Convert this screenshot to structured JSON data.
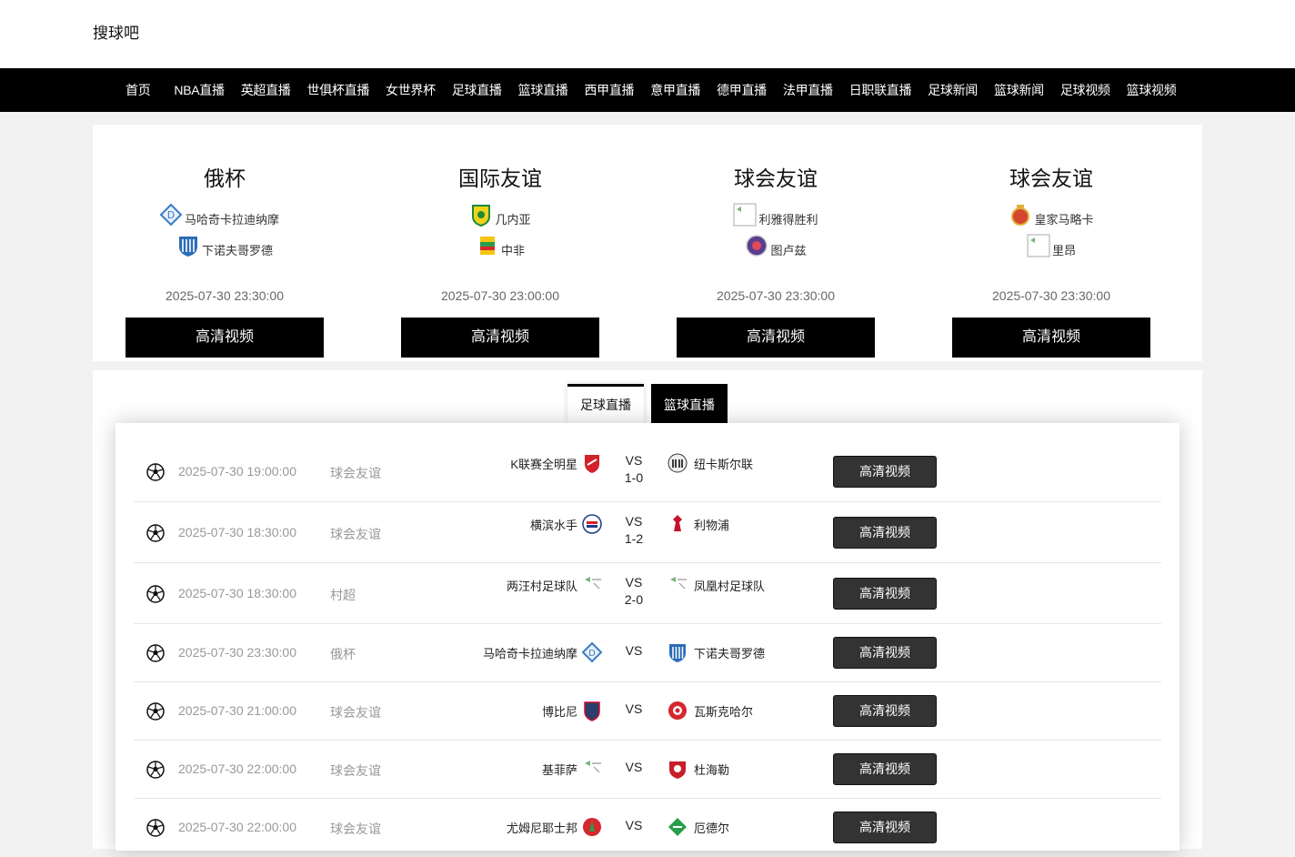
{
  "site": {
    "logo": "搜球吧"
  },
  "nav": [
    "首页",
    "NBA直播",
    "英超直播",
    "世俱杯直播",
    "女世界杯",
    "足球直播",
    "篮球直播",
    "西甲直播",
    "意甲直播",
    "德甲直播",
    "法甲直播",
    "日职联直播",
    "足球新闻",
    "篮球新闻",
    "足球视频",
    "篮球视频"
  ],
  "featured": [
    {
      "league": "俄杯",
      "home": "马哈奇卡拉迪纳摩",
      "away": "下诺夫哥罗德",
      "time": "2025-07-30 23:30:00",
      "button": "高清视频"
    },
    {
      "league": "国际友谊",
      "home": "几内亚",
      "away": "中非",
      "time": "2025-07-30 23:00:00",
      "button": "高清视频"
    },
    {
      "league": "球会友谊",
      "home": "利雅得胜利",
      "away": "图卢兹",
      "time": "2025-07-30 23:30:00",
      "button": "高清视频"
    },
    {
      "league": "球会友谊",
      "home": "皇家马略卡",
      "away": "里昂",
      "time": "2025-07-30 23:30:00",
      "button": "高清视频"
    }
  ],
  "tabs": {
    "football": "足球直播",
    "basketball": "篮球直播"
  },
  "matches": [
    {
      "time": "2025-07-30 19:00:00",
      "league": "球会友谊",
      "home": "K联赛全明星",
      "away": "纽卡斯尔联",
      "vs": "VS",
      "score": "1-0",
      "button": "高清视频"
    },
    {
      "time": "2025-07-30 18:30:00",
      "league": "球会友谊",
      "home": "横滨水手",
      "away": "利物浦",
      "vs": "VS",
      "score": "1-2",
      "button": "高清视频"
    },
    {
      "time": "2025-07-30 18:30:00",
      "league": "村超",
      "home": "两汪村足球队",
      "away": "凤凰村足球队",
      "vs": "VS",
      "score": "2-0",
      "button": "高清视频"
    },
    {
      "time": "2025-07-30 23:30:00",
      "league": "俄杯",
      "home": "马哈奇卡拉迪纳摩",
      "away": "下诺夫哥罗德",
      "vs": "VS",
      "score": "",
      "button": "高清视频"
    },
    {
      "time": "2025-07-30 21:00:00",
      "league": "球会友谊",
      "home": "博比尼",
      "away": "瓦斯克哈尔",
      "vs": "VS",
      "score": "",
      "button": "高清视频"
    },
    {
      "time": "2025-07-30 22:00:00",
      "league": "球会友谊",
      "home": "基菲萨",
      "away": "杜海勒",
      "vs": "VS",
      "score": "",
      "button": "高清视频"
    },
    {
      "time": "2025-07-30 22:00:00",
      "league": "球会友谊",
      "home": "尤姆尼耶士邦",
      "away": "厄德尔",
      "vs": "VS",
      "score": "",
      "button": "高清视频"
    }
  ],
  "colors": {
    "nav_bg": "#000000",
    "button_bg": "#000000",
    "row_button_bg": "#333333"
  }
}
